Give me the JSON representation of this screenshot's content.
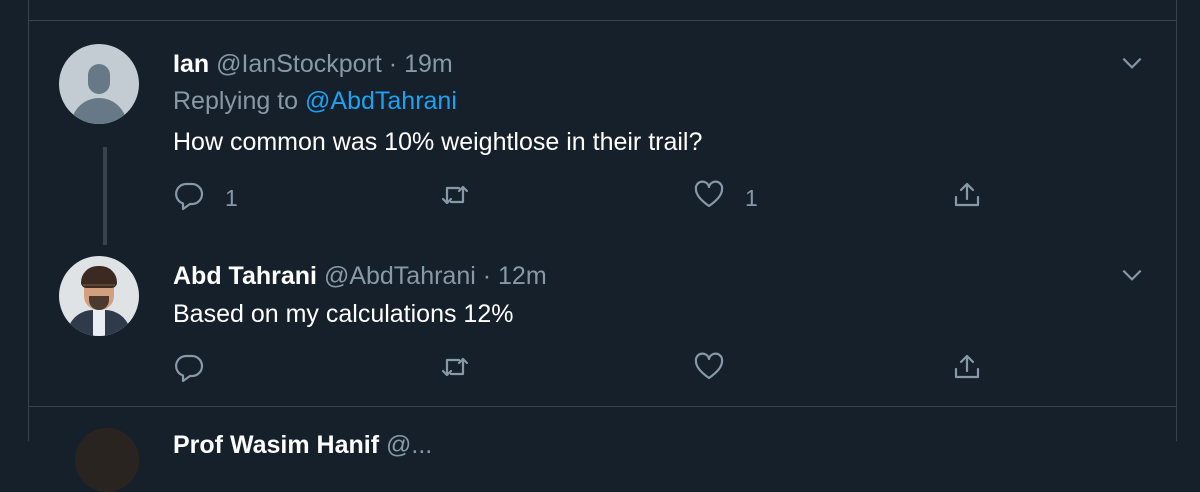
{
  "colors": {
    "background": "#15202b",
    "divider": "#38444d",
    "secondary_text": "#8899a6",
    "accent": "#1da1f2",
    "primary_text": "#ffffff"
  },
  "tweets": [
    {
      "name": "Ian",
      "handle": "@IanStockport",
      "separator": "·",
      "time": "19m",
      "reply_prefix": "Replying to",
      "reply_to": "@AbdTahrani",
      "text": "How common was 10% weightlose in their trail?",
      "avatar_icon": "default-user-avatar",
      "reply_count": "1",
      "retweet_count": "",
      "like_count": "1"
    },
    {
      "name": "Abd Tahrani",
      "handle": "@AbdTahrani",
      "separator": "·",
      "time": "12m",
      "text": "Based on my calculations 12%",
      "avatar_icon": "profile-photo-avatar",
      "reply_count": "",
      "retweet_count": "",
      "like_count": ""
    }
  ],
  "partial_next_tweet": {
    "name": "Prof Wasim Hanif",
    "handle": "@..."
  },
  "icons": {
    "reply": "reply-icon",
    "retweet": "retweet-icon",
    "like": "heart-icon",
    "share": "share-icon",
    "more": "chevron-down-icon"
  }
}
